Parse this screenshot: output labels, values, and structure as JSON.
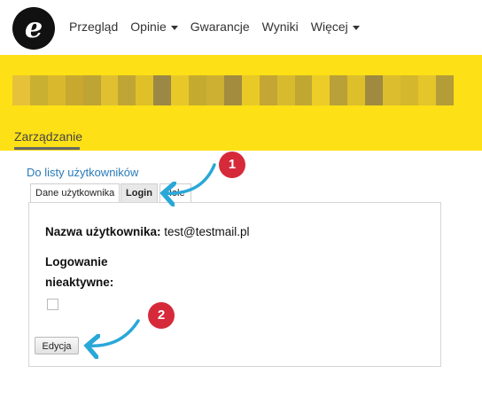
{
  "logo": {
    "letter": "e"
  },
  "nav": {
    "items": [
      {
        "label": "Przegląd",
        "has_caret": false
      },
      {
        "label": "Opinie",
        "has_caret": true
      },
      {
        "label": "Gwarancje",
        "has_caret": false
      },
      {
        "label": "Wyniki",
        "has_caret": false
      },
      {
        "label": "Więcej",
        "has_caret": true
      }
    ]
  },
  "band": {
    "color": "#fde016",
    "blur_colors": [
      "#e6c23a",
      "#b8a03a",
      "#d9b82e",
      "#c9a830",
      "#a89040",
      "#e0c030",
      "#bfa535",
      "#d4b530",
      "#9c8845",
      "#e8c828",
      "#b09a3a",
      "#cdb032",
      "#a38c3e",
      "#e2c22c",
      "#c3a633",
      "#d8ba2f",
      "#ab943c",
      "#eccc26",
      "#b9a038",
      "#d0b431",
      "#a08a40",
      "#dcbd2e",
      "#c6aa34",
      "#e4c52a",
      "#b49c39"
    ],
    "management_tab": "Zarządzanie"
  },
  "back_link": "Do listy użytkowników",
  "tabs": [
    {
      "label": "Dane użytkownika",
      "active": false
    },
    {
      "label": "Login",
      "active": true
    },
    {
      "label": "Role",
      "active": false
    }
  ],
  "panel": {
    "username_label": "Nazwa użytkownika:",
    "username_value": "test@testmail.pl",
    "inactive_label_line1": "Logowanie",
    "inactive_label_line2": "nieaktywne:",
    "inactive_checked": false,
    "edit_button": "Edycja"
  },
  "callouts": [
    {
      "number": "1"
    },
    {
      "number": "2"
    }
  ],
  "colors": {
    "accent_link": "#2a7ab8",
    "badge": "#d62a3a",
    "arrow": "#29a8d8"
  }
}
